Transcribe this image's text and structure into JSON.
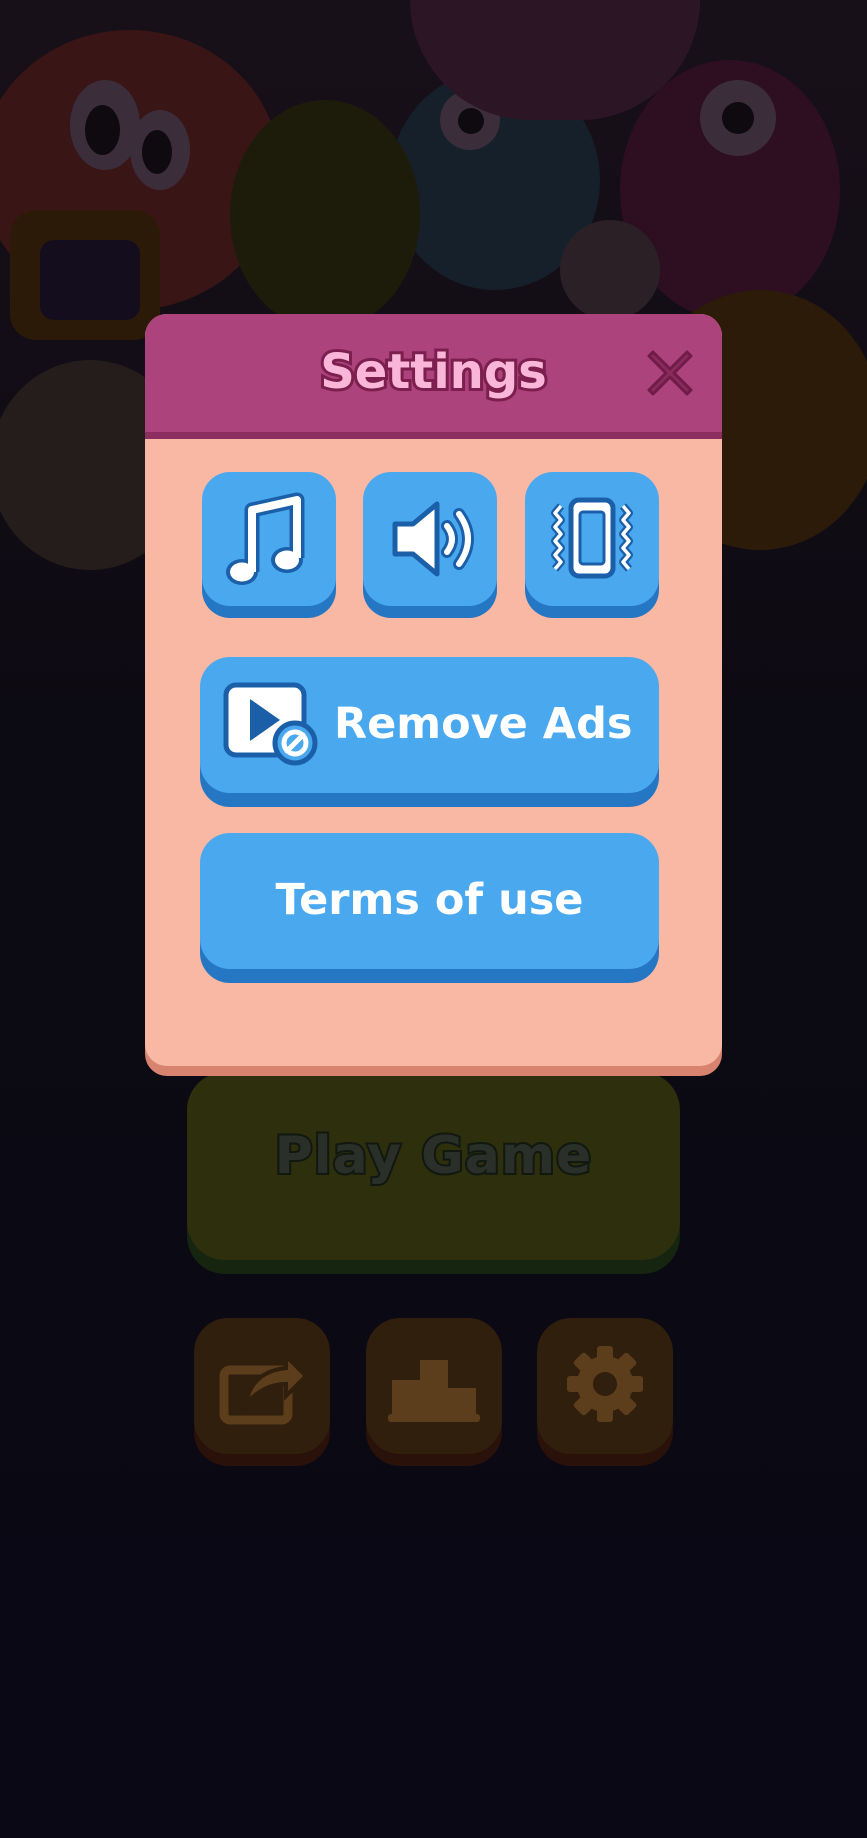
{
  "settings_modal": {
    "title": "Settings",
    "close_icon": "close-x-icon",
    "toggles": [
      {
        "name": "music",
        "icon": "music-note-icon"
      },
      {
        "name": "sound",
        "icon": "speaker-icon"
      },
      {
        "name": "vibration",
        "icon": "phone-vibrate-icon"
      }
    ],
    "remove_ads_label": "Remove Ads",
    "remove_ads_icon": "no-ads-icon",
    "terms_label": "Terms of use"
  },
  "main_menu": {
    "play_label": "Play Game",
    "share_icon": "share-icon",
    "leaderboard_icon": "podium-icon",
    "settings_icon": "gear-icon"
  },
  "colors": {
    "header": "#ad437d",
    "panel": "#f9b8a3",
    "button": "#4aa8ef",
    "button_shadow": "#2577c4",
    "title_text": "#f9b6d8"
  }
}
